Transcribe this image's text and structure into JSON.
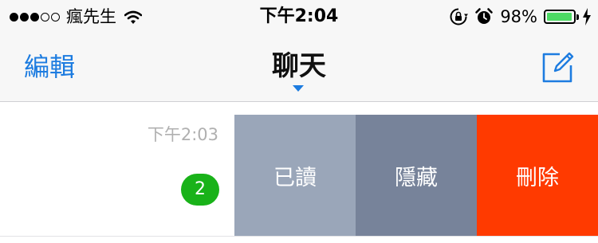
{
  "status_bar": {
    "signal_filled": 3,
    "signal_total": 5,
    "carrier": "瘋先生",
    "wifi_icon": "wifi-icon",
    "time": "下午2:04",
    "orientation_lock_icon": "orientation-lock-icon",
    "alarm_icon": "alarm-icon",
    "battery_percent_text": "98%",
    "battery_level": 0.98,
    "battery_color": "#4cd964",
    "charging_icon": "charging-bolt-icon"
  },
  "nav": {
    "edit_label": "編輯",
    "title": "聊天",
    "compose_icon": "compose-icon",
    "accent_color": "#1d7ce0"
  },
  "chat_row": {
    "time": "下午2:03",
    "unread_count": "2",
    "badge_color": "#19b219",
    "actions": {
      "read_label": "已讀",
      "hide_label": "隱藏",
      "delete_label": "刪除"
    },
    "action_colors": {
      "read": "#9aa6b9",
      "hide": "#77839a",
      "delete": "#ff3a00"
    }
  }
}
